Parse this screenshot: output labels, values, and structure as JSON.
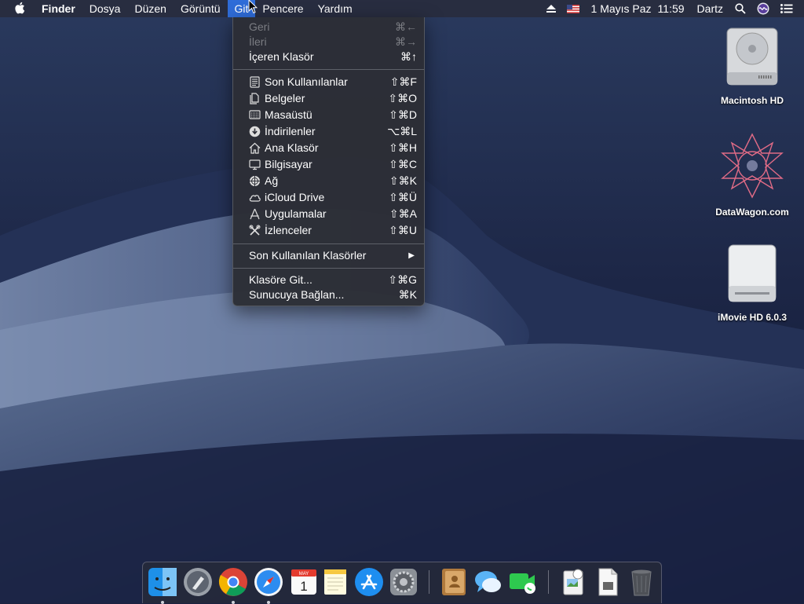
{
  "menubar": {
    "apple": "",
    "app_name": "Finder",
    "menus": [
      "Dosya",
      "Düzen",
      "Görüntü",
      "Git",
      "Pencere",
      "Yardım"
    ],
    "active_menu": "Git",
    "date": "1 Mayıs Paz",
    "time": "11:59",
    "user": "Dartz",
    "status_icons": [
      "eject-icon",
      "us-flag-icon",
      "spotlight-search-icon",
      "siri-icon",
      "notification-center-icon"
    ]
  },
  "go_menu": {
    "back": {
      "label": "Geri",
      "shortcut": "⌘←"
    },
    "forward": {
      "label": "İleri",
      "shortcut": "⌘→"
    },
    "enclosing": {
      "label": "İçeren Klasör",
      "shortcut": "⌘↑"
    },
    "items": [
      {
        "label": "Son Kullanılanlar",
        "shortcut": "⇧⌘F",
        "icon": "recents-icon"
      },
      {
        "label": "Belgeler",
        "shortcut": "⇧⌘O",
        "icon": "documents-icon"
      },
      {
        "label": "Masaüstü",
        "shortcut": "⇧⌘D",
        "icon": "desktop-icon"
      },
      {
        "label": "İndirilenler",
        "shortcut": "⌥⌘L",
        "icon": "downloads-icon"
      },
      {
        "label": "Ana Klasör",
        "shortcut": "⇧⌘H",
        "icon": "home-icon"
      },
      {
        "label": "Bilgisayar",
        "shortcut": "⇧⌘C",
        "icon": "computer-icon"
      },
      {
        "label": "Ağ",
        "shortcut": "⇧⌘K",
        "icon": "network-icon"
      },
      {
        "label": "iCloud Drive",
        "shortcut": "⇧⌘Ü",
        "icon": "icloud-icon"
      },
      {
        "label": "Uygulamalar",
        "shortcut": "⇧⌘A",
        "icon": "applications-icon"
      },
      {
        "label": "İzlenceler",
        "shortcut": "⇧⌘U",
        "icon": "utilities-icon"
      }
    ],
    "recent_folders": {
      "label": "Son Kullanılan Klasörler",
      "arrow": "▶"
    },
    "goto_folder": {
      "label": "Klasöre Git...",
      "shortcut": "⇧⌘G"
    },
    "connect_server": {
      "label": "Sunucuya Bağlan...",
      "shortcut": "⌘K"
    }
  },
  "desktop": {
    "icons": [
      {
        "label": "Macintosh HD",
        "icon": "hard-drive-icon"
      },
      {
        "label": "DataWagon.com",
        "icon": "datawagon-logo-icon"
      },
      {
        "label": "iMovie HD 6.0.3",
        "icon": "disk-image-icon"
      }
    ]
  },
  "dock": {
    "apps": [
      "Finder",
      "Launchpad",
      "Google Chrome",
      "Safari",
      "Calendar",
      "Notes",
      "App Store",
      "System Preferences",
      "Contacts",
      "Messages",
      "FaceTime",
      "Preview",
      "Document",
      "Trash"
    ],
    "calendar_month": "MAY",
    "calendar_day": "1"
  },
  "colors": {
    "menu_highlight": "#2f6cd8",
    "menu_bg": "#2c2e36",
    "sky_top": "#24304f",
    "sky_bottom": "#0e1430"
  }
}
